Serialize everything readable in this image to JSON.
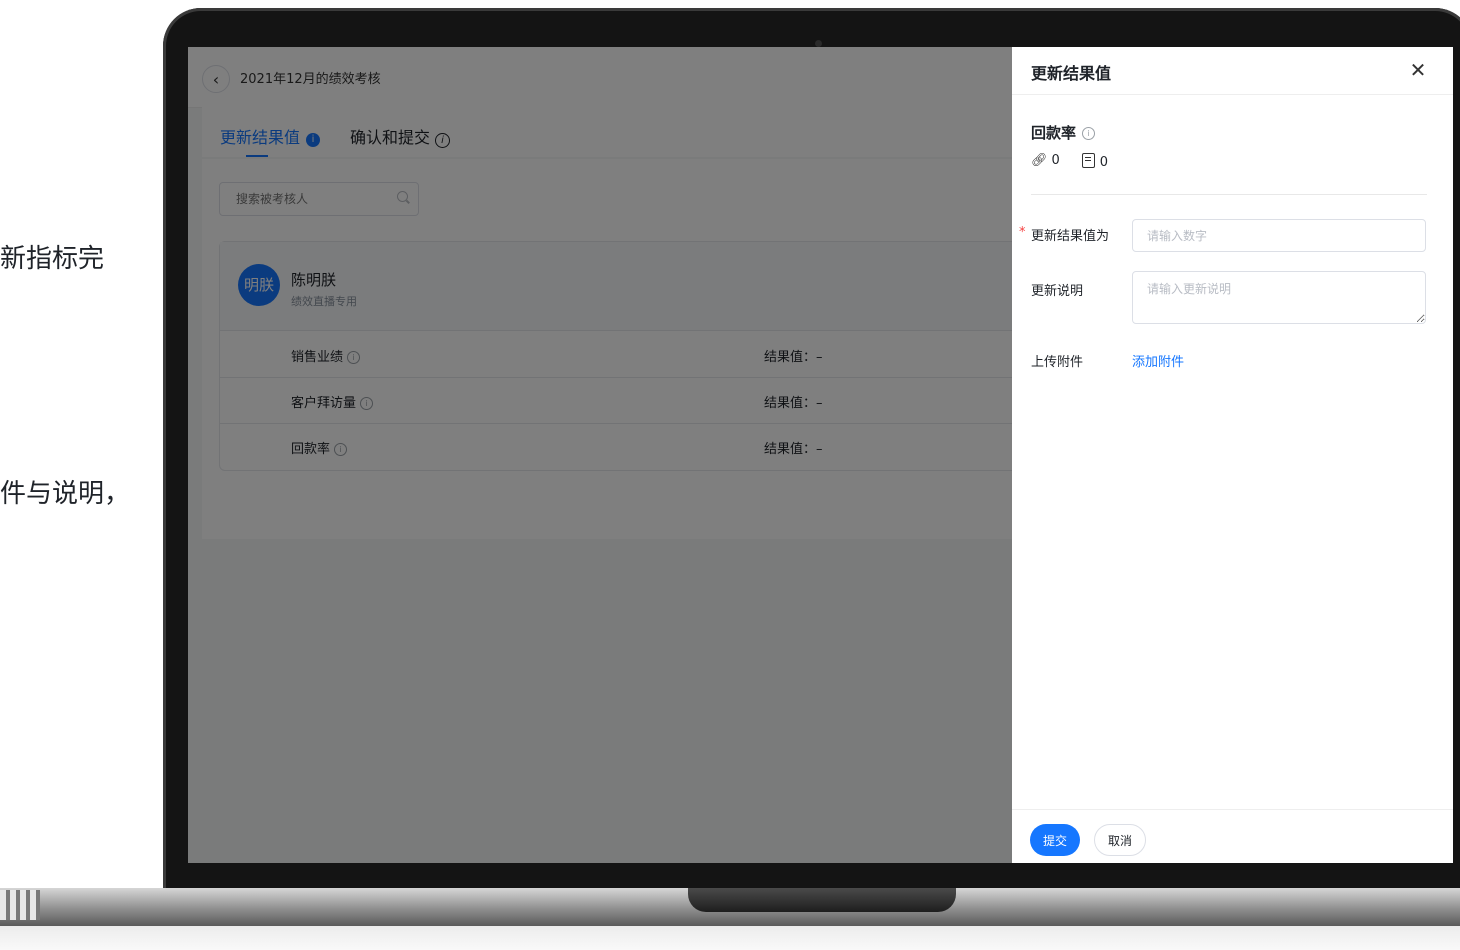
{
  "side_captions": {
    "line1": "新指标完",
    "line2": "件与说明，"
  },
  "header": {
    "breadcrumb": "2021年12月的绩效考核"
  },
  "tabs": [
    {
      "label": "更新结果值",
      "active": true
    },
    {
      "label": "确认和提交",
      "active": false
    }
  ],
  "search": {
    "placeholder": "搜索被考核人"
  },
  "person": {
    "avatar_text": "明朕",
    "name": "陈明朕",
    "subtitle": "绩效直播专用"
  },
  "metrics": [
    {
      "name": "销售业绩",
      "result": "结果值：–"
    },
    {
      "name": "客户拜访量",
      "result": "结果值：–"
    },
    {
      "name": "回款率",
      "result": "结果值：–"
    }
  ],
  "drawer": {
    "title": "更新结果值",
    "metric_title": "回款率",
    "link_count": "0",
    "doc_count": "0",
    "fields": {
      "value_label": "更新结果值为",
      "value_placeholder": "请输入数字",
      "desc_label": "更新说明",
      "desc_placeholder": "请输入更新说明",
      "attach_label": "上传附件",
      "attach_action": "添加附件"
    },
    "submit_label": "提交",
    "cancel_label": "取消"
  },
  "colors": {
    "accent": "#1677ff",
    "required": "#f53f3f"
  }
}
